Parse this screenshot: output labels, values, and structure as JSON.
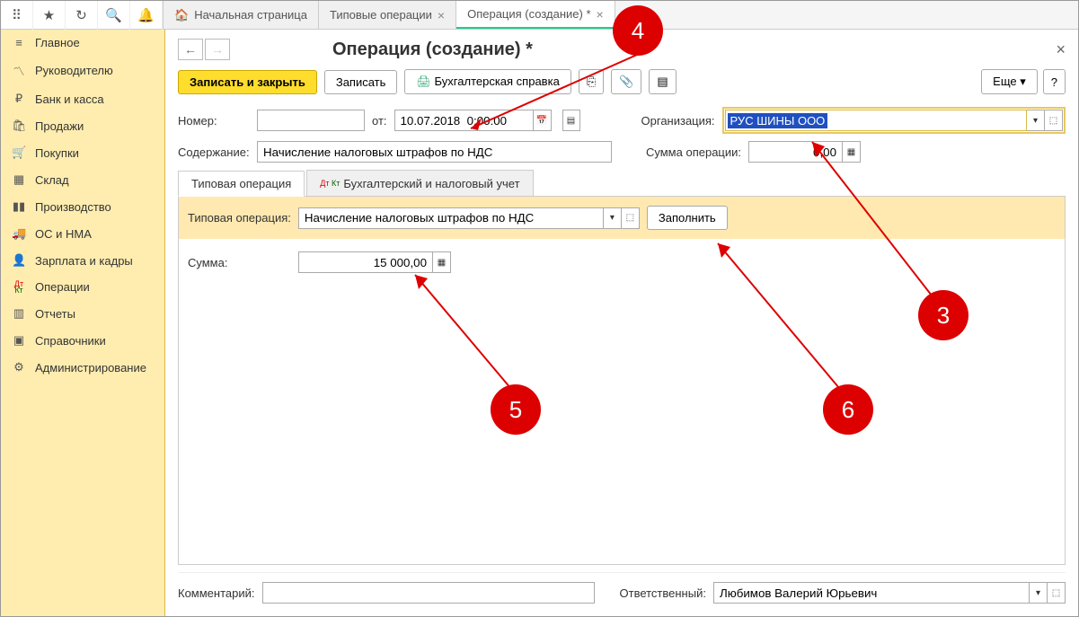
{
  "topbar": {
    "tabs": [
      {
        "label": "Начальная страница",
        "closable": false,
        "home": true
      },
      {
        "label": "Типовые операции",
        "closable": true
      },
      {
        "label": "Операция (создание) *",
        "closable": true,
        "active": true
      }
    ]
  },
  "sidebar": {
    "items": [
      {
        "icon": "≡",
        "label": "Главное"
      },
      {
        "icon": "📈",
        "label": "Руководителю"
      },
      {
        "icon": "₽",
        "label": "Банк и касса"
      },
      {
        "icon": "🛍",
        "label": "Продажи"
      },
      {
        "icon": "🛒",
        "label": "Покупки"
      },
      {
        "icon": "▦",
        "label": "Склад"
      },
      {
        "icon": "📊",
        "label": "Производство"
      },
      {
        "icon": "🚚",
        "label": "ОС и НМА"
      },
      {
        "icon": "👤",
        "label": "Зарплата и кадры"
      },
      {
        "icon": "Дт",
        "label": "Операции"
      },
      {
        "icon": "📊",
        "label": "Отчеты"
      },
      {
        "icon": "📕",
        "label": "Справочники"
      },
      {
        "icon": "⚙",
        "label": "Администрирование"
      }
    ]
  },
  "page": {
    "title": "Операция (создание) *",
    "toolbar": {
      "save_close": "Записать и закрыть",
      "save": "Записать",
      "print": "Бухгалтерская справка",
      "more": "Еще"
    },
    "fields": {
      "number_label": "Номер:",
      "number_value": "",
      "from_label": "от:",
      "date_value": "10.07.2018  0:00:00",
      "org_label": "Организация:",
      "org_value": "РУС ШИНЫ ООО",
      "content_label": "Содержание:",
      "content_value": "Начисление налоговых штрафов по НДС",
      "sum_label": "Сумма операции:",
      "sum_value": "0,00"
    },
    "doctabs": {
      "tab1": "Типовая операция",
      "tab2": "Бухгалтерский и налоговый учет"
    },
    "typop": {
      "label": "Типовая операция:",
      "value": "Начисление налоговых штрафов по НДС",
      "fill_btn": "Заполнить"
    },
    "amount": {
      "label": "Сумма:",
      "value": "15 000,00"
    },
    "footer": {
      "comment_label": "Комментарий:",
      "comment_value": "",
      "resp_label": "Ответственный:",
      "resp_value": "Любимов Валерий Юрьевич"
    }
  },
  "callouts": {
    "c3": "3",
    "c4": "4",
    "c5": "5",
    "c6": "6"
  }
}
